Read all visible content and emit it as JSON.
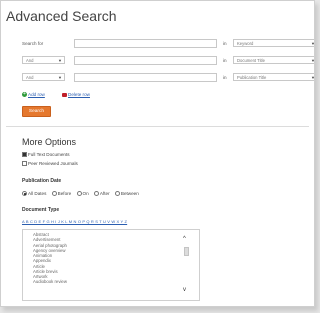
{
  "title": "Advanced Search",
  "search_rows": [
    {
      "label": "Search for",
      "operator": "",
      "in": "in",
      "field": "Keyword"
    },
    {
      "label": "",
      "operator": "And",
      "in": "in",
      "field": "Document Title"
    },
    {
      "label": "",
      "operator": "And",
      "in": "in",
      "field": "Publication Title"
    }
  ],
  "add_row": "Add row",
  "delete_row": "Delete row",
  "search_button": "Search",
  "more_options": "More Options",
  "checkboxes": [
    {
      "label": "Full Text Documents",
      "checked": true
    },
    {
      "label": "Peer Reviewed Journals",
      "checked": false
    }
  ],
  "publication_date": {
    "heading": "Publication Date",
    "options": [
      {
        "label": "All Dates",
        "selected": true
      },
      {
        "label": "Before",
        "selected": false
      },
      {
        "label": "On",
        "selected": false
      },
      {
        "label": "After",
        "selected": false
      },
      {
        "label": "Between",
        "selected": false
      }
    ]
  },
  "document_type": {
    "heading": "Document Type",
    "alphabet": "A B C D E F G H I J K L M N O P Q R S T U V W X Y Z",
    "items": [
      "Abstract",
      "Advertisement",
      "Aerial photograph",
      "Agency overview",
      "Animation",
      "Appendix",
      "Article",
      "Article brevis",
      "Artwork",
      "Audiobook review"
    ]
  },
  "colors": {
    "accent": "#e5782e",
    "link": "#2a5db0"
  }
}
